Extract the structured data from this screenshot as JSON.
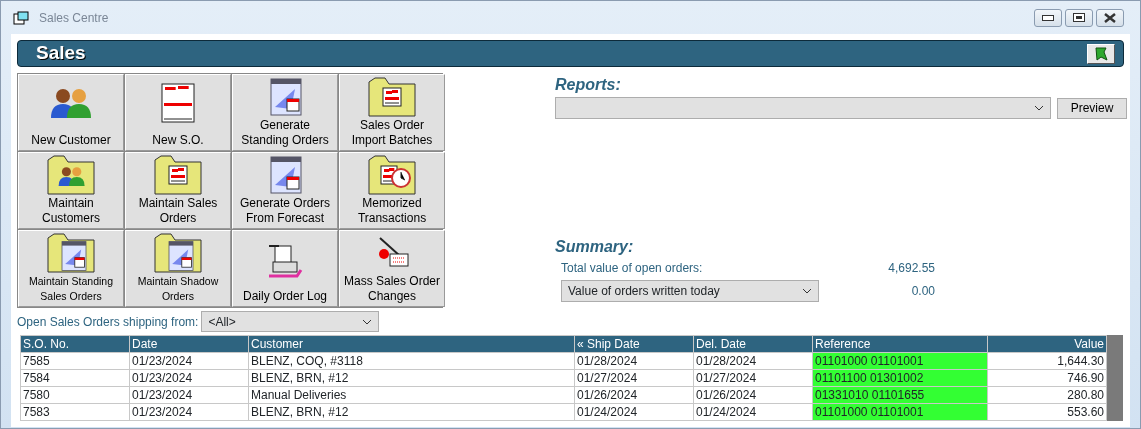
{
  "window": {
    "title": "Sales Centre"
  },
  "header": {
    "title": "Sales"
  },
  "tiles": [
    {
      "label": "New Customer",
      "kind": "people"
    },
    {
      "label": "New S.O.",
      "kind": "form"
    },
    {
      "label": "Generate Standing Orders",
      "kind": "calendar"
    },
    {
      "label": "Sales Order Import Batches",
      "kind": "folder-form"
    },
    {
      "label": "Maintain Customers",
      "kind": "folder-people"
    },
    {
      "label": "Maintain Sales Orders",
      "kind": "folder-form"
    },
    {
      "label": "Generate Orders From Forecast",
      "kind": "calendar"
    },
    {
      "label": "Memorized Transactions",
      "kind": "folder-clock"
    },
    {
      "label": "Maintain Standing Sales Orders",
      "kind": "folder-calendar"
    },
    {
      "label": "Maintain Shadow Orders",
      "kind": "folder-calendar"
    },
    {
      "label": "Daily Order Log",
      "kind": "printer"
    },
    {
      "label": "Mass Sales Order Changes",
      "kind": "pen"
    }
  ],
  "reports": {
    "heading": "Reports:",
    "button": "Preview"
  },
  "summary": {
    "heading": "Summary:",
    "total_label": "Total value of open orders:",
    "total_value": "4,692.55",
    "period_select": "Value of orders written today",
    "period_value": "0.00"
  },
  "filter": {
    "label": "Open Sales Orders shipping from:",
    "value": "<All>"
  },
  "table": {
    "columns": [
      "S.O. No.",
      "Date",
      "Customer",
      "« Ship Date",
      "Del. Date",
      "Reference",
      "Value"
    ],
    "rows": [
      {
        "cells": [
          "7585",
          "01/23/2024",
          "BLENZ, COQ, #3118",
          "01/28/2024",
          "01/28/2024",
          "01101000 01101001",
          "1,644.30"
        ],
        "highlighted": true
      },
      {
        "cells": [
          "7584",
          "01/23/2024",
          "BLENZ, BRN, #12",
          "01/27/2024",
          "01/27/2024",
          "01101100 01301002",
          "746.90"
        ],
        "highlighted": true
      },
      {
        "cells": [
          "7580",
          "01/23/2024",
          "Manual Deliveries",
          "01/26/2024",
          "01/26/2024",
          "01331010 01101655",
          "280.80"
        ],
        "highlighted": true
      },
      {
        "cells": [
          "7583",
          "01/23/2024",
          "BLENZ, BRN, #12",
          "01/24/2024",
          "01/24/2024",
          "01101000 01101001",
          "553.60"
        ],
        "highlighted": true
      }
    ]
  }
}
